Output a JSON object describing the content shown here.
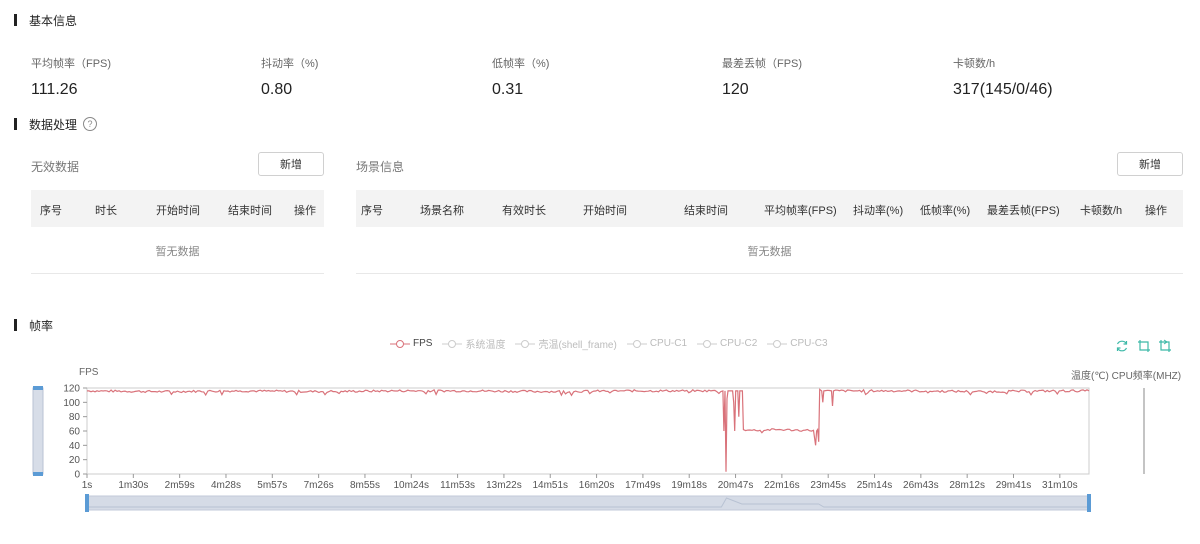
{
  "basic": {
    "title": "基本信息",
    "stats": [
      {
        "label": "平均帧率（FPS)",
        "value": "111.26"
      },
      {
        "label": "抖动率（%)",
        "value": "0.80"
      },
      {
        "label": "低帧率（%)",
        "value": "0.31"
      },
      {
        "label": "最差丢帧（FPS)",
        "value": "120"
      },
      {
        "label": "卡顿数/h",
        "value": "317(145/0/46)"
      }
    ]
  },
  "processing": {
    "title": "数据处理",
    "help_icon": "question-circle-icon",
    "invalid": {
      "title": "无效数据",
      "add_label": "新增",
      "columns": [
        "序号",
        "时长",
        "开始时间",
        "结束时间",
        "操作"
      ],
      "empty_text": "暂无数据"
    },
    "scene": {
      "title": "场景信息",
      "add_label": "新增",
      "columns": [
        "序号",
        "场景名称",
        "有效时长",
        "开始时间",
        "结束时间",
        "平均帧率(FPS)",
        "抖动率(%)",
        "低帧率(%)",
        "最差丢帧(FPS)",
        "卡顿数/h",
        "操作"
      ],
      "empty_text": "暂无数据"
    }
  },
  "fps_section": {
    "title": "帧率",
    "toolbox": [
      "refresh-icon",
      "crop-icon",
      "crop-reset-icon"
    ],
    "accent_color": "#3cb9a8"
  },
  "chart_data": {
    "type": "line",
    "ylabel": "FPS",
    "right_labels": [
      "温度(℃)",
      "CPU频率(MHZ)"
    ],
    "legend": [
      {
        "name": "FPS",
        "active": true,
        "color": "#d9727a"
      },
      {
        "name": "系统温度",
        "active": false,
        "color": "#cccccc"
      },
      {
        "name": "壳温(shell_frame)",
        "active": false,
        "color": "#cccccc"
      },
      {
        "name": "CPU-C1",
        "active": false,
        "color": "#cccccc"
      },
      {
        "name": "CPU-C2",
        "active": false,
        "color": "#cccccc"
      },
      {
        "name": "CPU-C3",
        "active": false,
        "color": "#cccccc"
      }
    ],
    "ylim": [
      0,
      120
    ],
    "yticks": [
      0,
      20,
      40,
      60,
      80,
      100,
      120
    ],
    "xticks": [
      "1s",
      "1m30s",
      "2m59s",
      "4m28s",
      "5m57s",
      "7m26s",
      "8m55s",
      "10m24s",
      "11m53s",
      "13m22s",
      "14m51s",
      "16m20s",
      "17m49s",
      "19m18s",
      "20m47s",
      "22m16s",
      "23m45s",
      "25m14s",
      "26m43s",
      "28m12s",
      "29m41s",
      "31m10s"
    ],
    "xrange_seconds": [
      1,
      1958
    ],
    "series": [
      {
        "name": "FPS",
        "color": "#d9727a",
        "points": [
          [
            1,
            116
          ],
          [
            150,
            115
          ],
          [
            300,
            116
          ],
          [
            450,
            115
          ],
          [
            600,
            116
          ],
          [
            750,
            116
          ],
          [
            900,
            115
          ],
          [
            1050,
            116
          ],
          [
            1200,
            116
          ],
          [
            1243,
            116
          ],
          [
            1245,
            60
          ],
          [
            1247,
            116
          ],
          [
            1249,
            3
          ],
          [
            1251,
            105
          ],
          [
            1253,
            116
          ],
          [
            1262,
            116
          ],
          [
            1264,
            100
          ],
          [
            1266,
            60
          ],
          [
            1268,
            116
          ],
          [
            1272,
            116
          ],
          [
            1274,
            80
          ],
          [
            1276,
            116
          ],
          [
            1281,
            116
          ],
          [
            1283,
            62
          ],
          [
            1300,
            61
          ],
          [
            1350,
            62
          ],
          [
            1400,
            61
          ],
          [
            1420,
            61
          ],
          [
            1422,
            50
          ],
          [
            1424,
            40
          ],
          [
            1426,
            60
          ],
          [
            1428,
            62
          ],
          [
            1430,
            45
          ],
          [
            1432,
            118
          ],
          [
            1436,
            116
          ],
          [
            1438,
            100
          ],
          [
            1440,
            116
          ],
          [
            1455,
            116
          ],
          [
            1457,
            95
          ],
          [
            1459,
            116
          ],
          [
            1600,
            116
          ],
          [
            1750,
            115
          ],
          [
            1900,
            116
          ],
          [
            1958,
            116
          ]
        ]
      }
    ],
    "zoom_range": [
      0,
      100
    ]
  }
}
